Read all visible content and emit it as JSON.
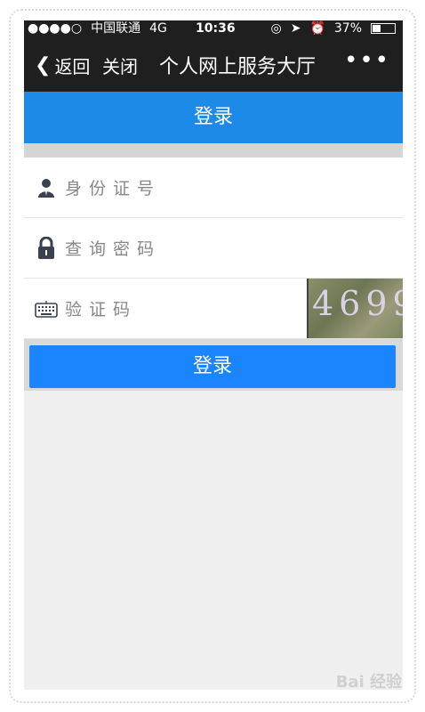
{
  "status": {
    "dots": "●●●●○",
    "carrier": "中国联通",
    "network": "4G",
    "time": "10:36",
    "battery_pct": "37%",
    "battery_level": 0.37
  },
  "nav": {
    "back_label": "返回",
    "close_label": "关闭",
    "title": "个人网上服务大厅",
    "more_label": "•••"
  },
  "header": {
    "title": "登录"
  },
  "form": {
    "id_label": "身份证号",
    "password_label": "查询密码",
    "captcha_label": "验证码",
    "captcha_image_text": "4699"
  },
  "login_button": "登录",
  "colors": {
    "accent": "#1b84ff",
    "header_blue": "#1e8ae8",
    "dark_bar": "#1f1f1f"
  },
  "watermark": "Bai 经验"
}
